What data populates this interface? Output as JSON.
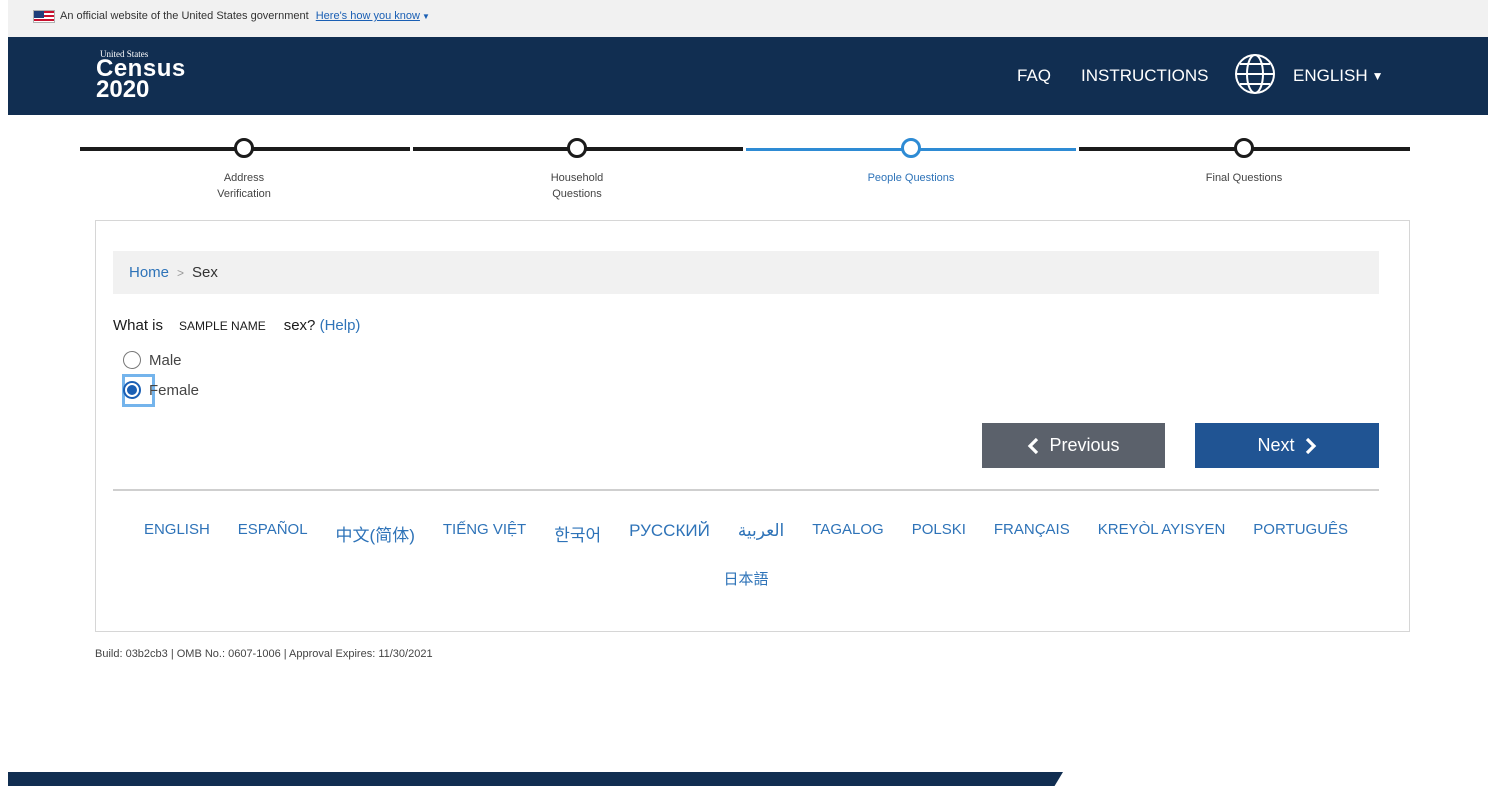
{
  "gov_banner": {
    "text": "An official website of the United States government",
    "link": "Here's how you know"
  },
  "header": {
    "logo": {
      "top": "United States",
      "name": "Census",
      "year": "2020"
    },
    "nav": {
      "faq": "FAQ",
      "instructions": "INSTRUCTIONS",
      "language": "ENGLISH"
    }
  },
  "progress": {
    "steps": [
      {
        "line1": "Address",
        "line2": "Verification",
        "status": "complete"
      },
      {
        "line1": "Household",
        "line2": "Questions",
        "status": "complete"
      },
      {
        "line1": "People Questions",
        "line2": "",
        "status": "current"
      },
      {
        "line1": "Final Questions",
        "line2": "",
        "status": "upcoming"
      }
    ]
  },
  "breadcrumb": {
    "home": "Home",
    "separator": ">",
    "current": "Sex"
  },
  "question": {
    "prefix": "What is",
    "name": "SAMPLE NAME",
    "suffix": "sex?",
    "help": "(Help)",
    "options": [
      {
        "label": "Male",
        "checked": false
      },
      {
        "label": "Female",
        "checked": true
      }
    ]
  },
  "buttons": {
    "previous": "Previous",
    "next": "Next"
  },
  "languages": {
    "row1": [
      "ENGLISH",
      "ESPAÑOL",
      "中文(简体)",
      "TIẾNG VIỆT",
      "한국어",
      "РУССКИЙ",
      "العربية",
      "TAGALOG",
      "POLSKI",
      "FRANÇAIS",
      "KREYÒL AYISYEN",
      "PORTUGUÊS"
    ],
    "row2": [
      "日本語"
    ]
  },
  "build_info": "Build: 03b2cb3 | OMB No.: 0607-1006 | Approval Expires: 11/30/2021",
  "colors": {
    "header_bg": "#112e51",
    "progress_active": "#2e8bd4",
    "link": "#2e73b8",
    "previous_button": "#5b616b",
    "next_button": "#205493"
  }
}
